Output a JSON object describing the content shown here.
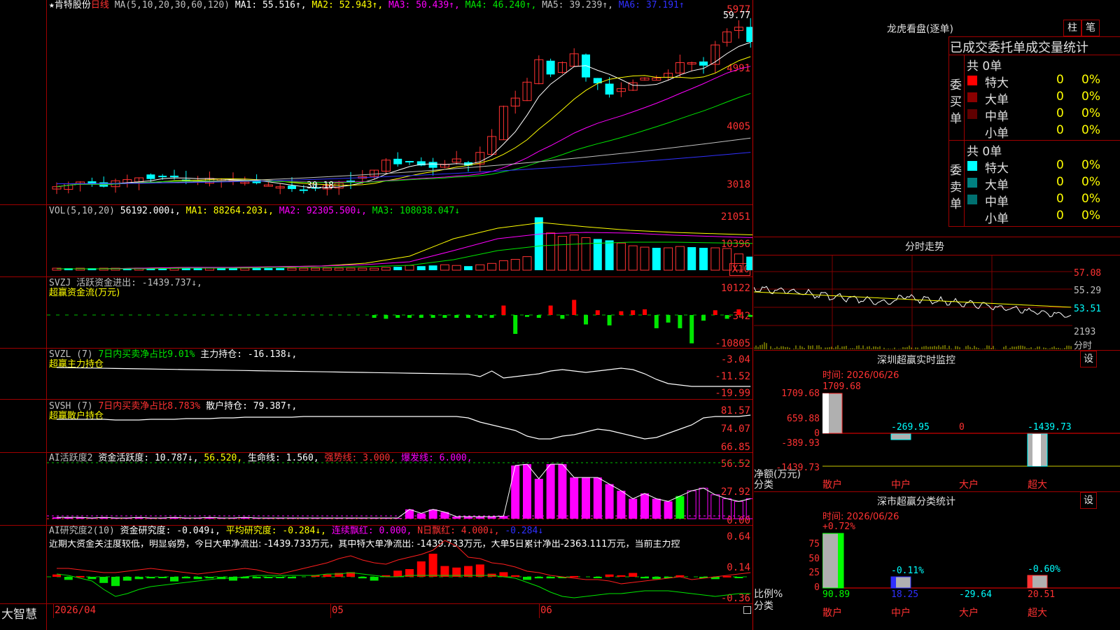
{
  "stock": {
    "name": "肯特股份",
    "period": "日线",
    "star": "★"
  },
  "price_axis": {
    "ticks": [
      "5977",
      "4991",
      "4005",
      "3018"
    ]
  },
  "ma_legend": {
    "label": "MA(5,10,20,30,60,120)",
    "items": [
      {
        "text": "MA1: 55.516↑,",
        "color": "#ffffff"
      },
      {
        "text": "MA2: 52.943↑,",
        "color": "#ffff00"
      },
      {
        "text": "MA3: 50.439↑,",
        "color": "#ff00ff"
      },
      {
        "text": "MA4: 46.240↑,",
        "color": "#00e600"
      },
      {
        "text": "MA5: 39.239↑,",
        "color": "#c0c0c0"
      },
      {
        "text": "MA6: 37.191↑",
        "color": "#3030ff"
      }
    ]
  },
  "annotations": {
    "high": "59.77",
    "low": "30.18"
  },
  "vol_panel": {
    "ticks": [
      "21051",
      "10396",
      "X10"
    ],
    "legend": [
      {
        "text": "VOL(5,10,20)",
        "color": "#c0c0c0"
      },
      {
        "text": "56192.000↓,",
        "color": "#ffffff"
      },
      {
        "text": "MA1: 88264.203↓,",
        "color": "#ffff00"
      },
      {
        "text": "MA2: 92305.500↓,",
        "color": "#ff00ff"
      },
      {
        "text": "MA3: 108038.047↓",
        "color": "#00e600"
      }
    ]
  },
  "svzj_panel": {
    "ticks": [
      "10122",
      "-342",
      "-10805"
    ],
    "line1": [
      {
        "text": "SVZJ  活跃资金进出: -1439.737↓,",
        "color": "#c0c0c0"
      }
    ],
    "line2": "超赢资金流(万元)"
  },
  "svzl_panel": {
    "ticks": [
      "-3.04",
      "-11.52",
      "-19.99"
    ],
    "line1": [
      {
        "text": "SVZL (7)",
        "color": "#c0c0c0"
      },
      {
        "text": "7日内买卖净占比9.01%",
        "color": "#00e600"
      },
      {
        "text": "主力持仓: -16.138↓,",
        "color": "#ffffff"
      }
    ],
    "line2": "超赢主力持仓"
  },
  "svsh_panel": {
    "ticks": [
      "81.57",
      "74.07",
      "66.85"
    ],
    "line1": [
      {
        "text": "SVSH (7)",
        "color": "#c0c0c0"
      },
      {
        "text": "7日内买卖净占比8.783%",
        "color": "#ff3232"
      },
      {
        "text": "散户持仓: 79.387↑,",
        "color": "#ffffff"
      }
    ],
    "line2": "超赢散户持仓"
  },
  "ai_active_panel": {
    "ticks": [
      "56.52",
      "27.92",
      "0.00"
    ],
    "line1": [
      {
        "text": "AI活跃度2",
        "color": "#c0c0c0"
      },
      {
        "text": "资金活跃度: 10.787↓,",
        "color": "#ffffff"
      },
      {
        "text": "56.520,",
        "color": "#ffff00"
      },
      {
        "text": "生命线: 1.560,",
        "color": "#ffffff"
      },
      {
        "text": "强势线: 3.000,",
        "color": "#ff3232"
      },
      {
        "text": "爆发线: 6.000,",
        "color": "#ff00ff"
      }
    ]
  },
  "ai_research_panel": {
    "ticks": [
      "0.64",
      "0.14",
      "-0.36"
    ],
    "line1": [
      {
        "text": "AI研究度2(10)",
        "color": "#c0c0c0"
      },
      {
        "text": "资金研究度: -0.049↓,",
        "color": "#ffffff"
      },
      {
        "text": "平均研究度: -0.284↓,",
        "color": "#ffff00"
      },
      {
        "text": "连续飘红: 0.000,",
        "color": "#ff00ff"
      },
      {
        "text": "N日飘红: 4.000↓,",
        "color": "#ff3232"
      },
      {
        "text": "-0.284↓",
        "color": "#3030ff"
      }
    ],
    "line2": "近期大资金关注度较低，明显弱势，今日大单净流出: -1439.733万元，其中特大单净流出: -1439.733万元，大单5日累计净出-2363.111万元，当前主力控"
  },
  "date_axis": {
    "labels": [
      "2026/04",
      "05",
      "06"
    ],
    "brand": "大智慧"
  },
  "right_panel": {
    "title": "龙虎看盘(逐单)",
    "btn_zhu": "柱",
    "btn_bi": "笔",
    "tabs": "已成交委托单成交量统计",
    "buy_group": {
      "label": "委买单",
      "total": "共 0单",
      "rows": [
        {
          "name": "特大",
          "val": "0",
          "pct": "0%",
          "color": "#ff0000"
        },
        {
          "name": "大单",
          "val": "0",
          "pct": "0%",
          "color": "#8b0000"
        },
        {
          "name": "中单",
          "val": "0",
          "pct": "0%",
          "color": "#600000"
        },
        {
          "name": "小单",
          "val": "0",
          "pct": "0%",
          "color": "#000000"
        }
      ]
    },
    "sell_group": {
      "label": "委卖单",
      "total": "共 0单",
      "rows": [
        {
          "name": "特大",
          "val": "0",
          "pct": "0%",
          "color": "#00ffff"
        },
        {
          "name": "大单",
          "val": "0",
          "pct": "0%",
          "color": "#008080"
        },
        {
          "name": "中单",
          "val": "0",
          "pct": "0%",
          "color": "#007070"
        },
        {
          "name": "小单",
          "val": "0",
          "pct": "0%",
          "color": "#000000"
        }
      ]
    },
    "intraday": {
      "title": "分时走势",
      "ticks": [
        "57.08",
        "55.29",
        "53.51",
        "2193",
        "分时"
      ]
    },
    "sz_monitor": {
      "title": "深圳超赢实时监控",
      "btn": "设",
      "time": "时间: 2026/06/26",
      "ticks": [
        "1709.68",
        "659.88",
        "0",
        "-389.93",
        "-1439.73"
      ],
      "top_label": "1709.68",
      "net_label": "净额(万元)",
      "cat_label": "分类",
      "cats": [
        "散户",
        "中户",
        "大户",
        "超大"
      ],
      "vals": [
        "",
        "-269.95",
        "0",
        "-1439.73"
      ]
    },
    "sz_class": {
      "title": "深市超赢分类统计",
      "btn": "设",
      "time": "时间: 2026/06/26",
      "ticks": [
        "75",
        "50",
        "25",
        "0"
      ],
      "pcts": [
        "+0.72%",
        "-0.11%",
        "",
        "-0.60%"
      ],
      "ratio_label": "比例%",
      "cat_label": "分类",
      "cats": [
        "散户",
        "中户",
        "大户",
        "超大"
      ],
      "vals": [
        "90.89",
        "18.25",
        "-29.64",
        "20.51"
      ]
    }
  }
}
